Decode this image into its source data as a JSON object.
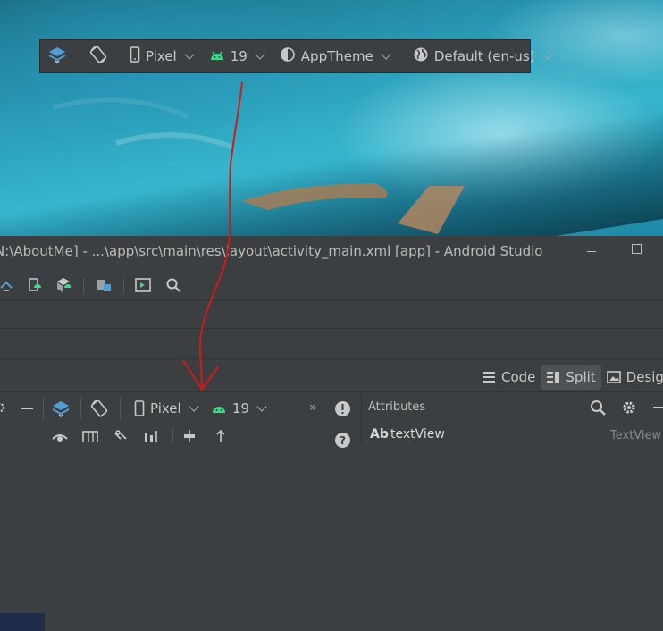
{
  "floating_toolbar": {
    "layers_icon": "layers-icon",
    "orientation_icon": "rotate-icon",
    "device_label": "Pixel",
    "api_label": "19",
    "theme_label": "AppTheme",
    "locale_label": "Default (en-us)"
  },
  "window": {
    "title": "N:\\AboutMe] - ...\\app\\src\\main\\res\\layout\\activity_main.xml [app] - Android Studio"
  },
  "view_switch": {
    "code_label": "Code",
    "split_label": "Split",
    "design_label": "Design"
  },
  "design_toolbar": {
    "device_label": "Pixel",
    "api_label": "19",
    "more_label": "»"
  },
  "attributes_panel": {
    "title": "Attributes",
    "component_prefix": "Ab",
    "component_name": "textView",
    "component_type": "TextView"
  },
  "colors": {
    "ide_bg": "#3c3f41",
    "android_green": "#3ddc84",
    "accent_blue": "#4e9fd6",
    "annotation_red": "#d01a1a"
  }
}
